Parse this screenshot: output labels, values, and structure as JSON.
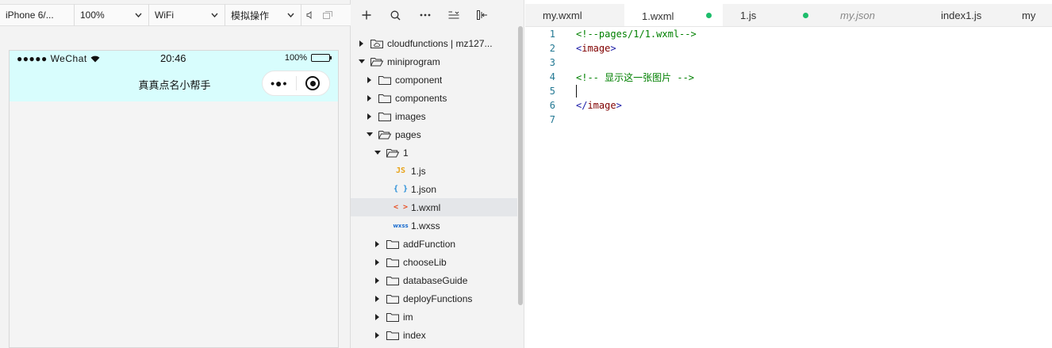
{
  "toolbar": {
    "device": "iPhone 6/...",
    "zoom": "100%",
    "network": "WiFi",
    "mode": "模拟操作"
  },
  "phone": {
    "status_left": "●●●●● WeChat",
    "time": "20:46",
    "battery": "100%",
    "nav_title": "真真点名小帮手",
    "nav_bg_color": "#d8fdfd"
  },
  "explorer": {
    "tree": [
      {
        "label": "cloudfunctions | mz127...",
        "depth": 0,
        "type": "cloudfolder",
        "expanded": false
      },
      {
        "label": "miniprogram",
        "depth": 0,
        "type": "folder",
        "expanded": true
      },
      {
        "label": "component",
        "depth": 1,
        "type": "folder",
        "expanded": false
      },
      {
        "label": "components",
        "depth": 1,
        "type": "folder",
        "expanded": false
      },
      {
        "label": "images",
        "depth": 1,
        "type": "folder",
        "expanded": false
      },
      {
        "label": "pages",
        "depth": 1,
        "type": "folder",
        "expanded": true
      },
      {
        "label": "1",
        "depth": 2,
        "type": "folder",
        "expanded": true
      },
      {
        "label": "1.js",
        "depth": 3,
        "type": "js"
      },
      {
        "label": "1.json",
        "depth": 3,
        "type": "json"
      },
      {
        "label": "1.wxml",
        "depth": 3,
        "type": "wxml",
        "selected": true
      },
      {
        "label": "1.wxss",
        "depth": 3,
        "type": "wxss"
      },
      {
        "label": "addFunction",
        "depth": 2,
        "type": "folder",
        "expanded": false
      },
      {
        "label": "chooseLib",
        "depth": 2,
        "type": "folder",
        "expanded": false
      },
      {
        "label": "databaseGuide",
        "depth": 2,
        "type": "folder",
        "expanded": false
      },
      {
        "label": "deployFunctions",
        "depth": 2,
        "type": "folder",
        "expanded": false
      },
      {
        "label": "im",
        "depth": 2,
        "type": "folder",
        "expanded": false
      },
      {
        "label": "index",
        "depth": 2,
        "type": "folder",
        "expanded": false
      }
    ]
  },
  "editor": {
    "tabs": [
      {
        "label": "my.wxml",
        "active": false,
        "modified": false,
        "italic": false
      },
      {
        "label": "1.wxml",
        "active": true,
        "modified": true,
        "italic": false
      },
      {
        "label": "1.js",
        "active": false,
        "modified": true,
        "italic": false
      },
      {
        "label": "my.json",
        "active": false,
        "modified": false,
        "italic": true
      },
      {
        "label": "index1.js",
        "active": false,
        "modified": false,
        "italic": false
      },
      {
        "label": "my",
        "active": false,
        "modified": false,
        "italic": false
      }
    ],
    "lines": [
      {
        "n": "1",
        "text": "<!--pages/1/1.wxml-->",
        "kind": "comment"
      },
      {
        "n": "2",
        "text": "<image>",
        "kind": "tag"
      },
      {
        "n": "3",
        "text": "",
        "kind": "plain"
      },
      {
        "n": "4",
        "text": "<!-- 显示这一张图片 -->",
        "kind": "comment"
      },
      {
        "n": "5",
        "text": "",
        "kind": "caret"
      },
      {
        "n": "6",
        "text": "</image>",
        "kind": "tag"
      },
      {
        "n": "7",
        "text": "",
        "kind": "plain"
      }
    ]
  },
  "colors": {
    "accent_modified": "#1dbd6b",
    "comment": "#008000",
    "tag": "#800000",
    "line_number": "#237893"
  }
}
